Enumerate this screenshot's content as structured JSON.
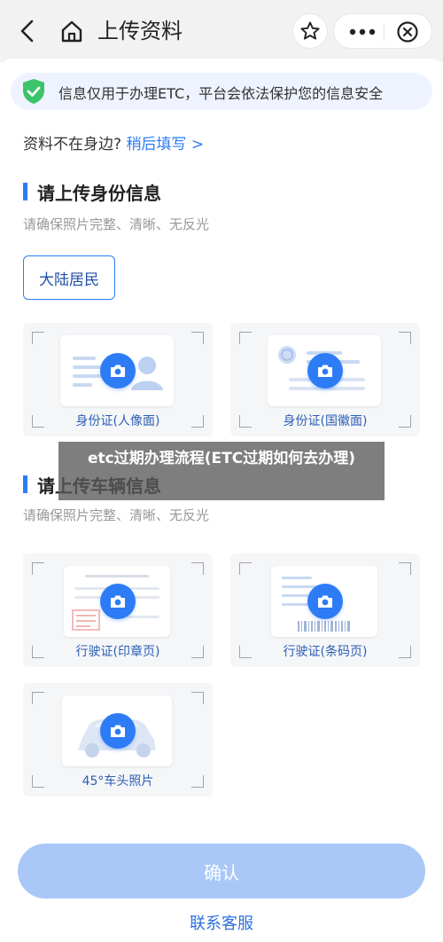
{
  "header": {
    "title": "上传资料"
  },
  "notice": {
    "text": "信息仅用于办理ETC，平台会依法保护您的信息安全"
  },
  "later": {
    "prompt": "资料不在身边?",
    "link": "稍后填写 >"
  },
  "id_section": {
    "title": "请上传身份信息",
    "subtitle": "请确保照片完整、清晰、无反光",
    "chip": "大陆居民",
    "tiles": [
      {
        "label": "身份证(人像面)"
      },
      {
        "label": "身份证(国徽面)"
      }
    ]
  },
  "vehicle_section": {
    "title": "请上传车辆信息",
    "subtitle": "请确保照片完整、清晰、无反光",
    "tiles": [
      {
        "label": "行驶证(印章页)"
      },
      {
        "label": "行驶证(条码页)"
      },
      {
        "label": "45°车头照片"
      }
    ]
  },
  "overlay": {
    "banner": "etc过期办理流程(ETC过期如何去办理)"
  },
  "footer": {
    "confirm": "确认",
    "contact": "联系客服"
  },
  "colors": {
    "accent": "#2d7cf5",
    "confirm_disabled": "#a9c8f7",
    "notice_bg": "#eef3ff",
    "shield": "#3cc46a"
  },
  "icons": [
    "back-arrow-icon",
    "home-icon",
    "star-icon",
    "more-icon",
    "close-circle-icon",
    "shield-check-icon",
    "camera-icon"
  ]
}
